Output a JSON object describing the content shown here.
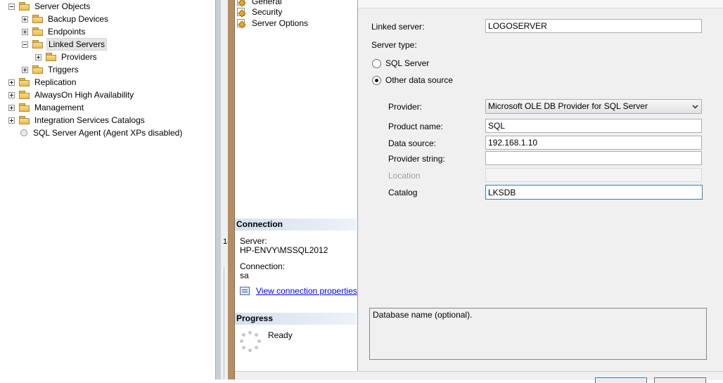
{
  "object_explorer": {
    "items": [
      {
        "label": "Server Objects",
        "expander": "minus",
        "icon": "folder-icon"
      },
      {
        "label": "Backup Devices",
        "expander": "plus",
        "icon": "folder-icon"
      },
      {
        "label": "Endpoints",
        "expander": "plus",
        "icon": "folder-icon"
      },
      {
        "label": "Linked Servers",
        "expander": "minus",
        "icon": "folder-icon",
        "selected": true
      },
      {
        "label": "Providers",
        "expander": "plus",
        "icon": "folder-icon"
      },
      {
        "label": "Triggers",
        "expander": "plus",
        "icon": "folder-icon"
      },
      {
        "label": "Replication",
        "expander": "plus",
        "icon": "folder-icon"
      },
      {
        "label": "AlwaysOn High Availability",
        "expander": "plus",
        "icon": "folder-icon"
      },
      {
        "label": "Management",
        "expander": "plus",
        "icon": "folder-icon"
      },
      {
        "label": "Integration Services Catalogs",
        "expander": "plus",
        "icon": "folder-icon"
      },
      {
        "label": "SQL Server Agent (Agent XPs disabled)",
        "expander": "none",
        "icon": "agent-icon"
      }
    ]
  },
  "background_window": {
    "snippet": "1("
  },
  "select_page": {
    "items": [
      {
        "label": "General",
        "icon": "page-icon"
      },
      {
        "label": "Security",
        "icon": "page-icon"
      },
      {
        "label": "Server Options",
        "icon": "page-icon"
      }
    ]
  },
  "connection": {
    "heading": "Connection",
    "server_label": "Server:",
    "server_value": "HP-ENVY\\MSSQL2012",
    "connection_label": "Connection:",
    "connection_value": "sa",
    "view_link": "View connection properties"
  },
  "progress": {
    "heading": "Progress",
    "status": "Ready"
  },
  "general": {
    "linked_server_label": "Linked server:",
    "linked_server_value": "LOGOSERVER",
    "server_type_label": "Server type:",
    "sql_server_option": "SQL Server",
    "other_source_option": "Other data source",
    "selected_server_type": "Other data source",
    "provider_label": "Provider:",
    "provider_value": "Microsoft OLE DB Provider for SQL Server",
    "product_name_label": "Product name:",
    "product_name_value": "SQL",
    "data_source_label": "Data source:",
    "data_source_value": "192.168.1.10",
    "provider_string_label": "Provider string:",
    "provider_string_value": "",
    "location_label": "Location",
    "location_value": "",
    "catalog_label": "Catalog",
    "catalog_value": "LKSDB",
    "description": "Database name (optional)."
  },
  "colors": {
    "section_header": "#d5e0ee",
    "link": "#0000ee",
    "focus_border": "#3c7fb1",
    "dialog_frame": "#b48e62"
  }
}
